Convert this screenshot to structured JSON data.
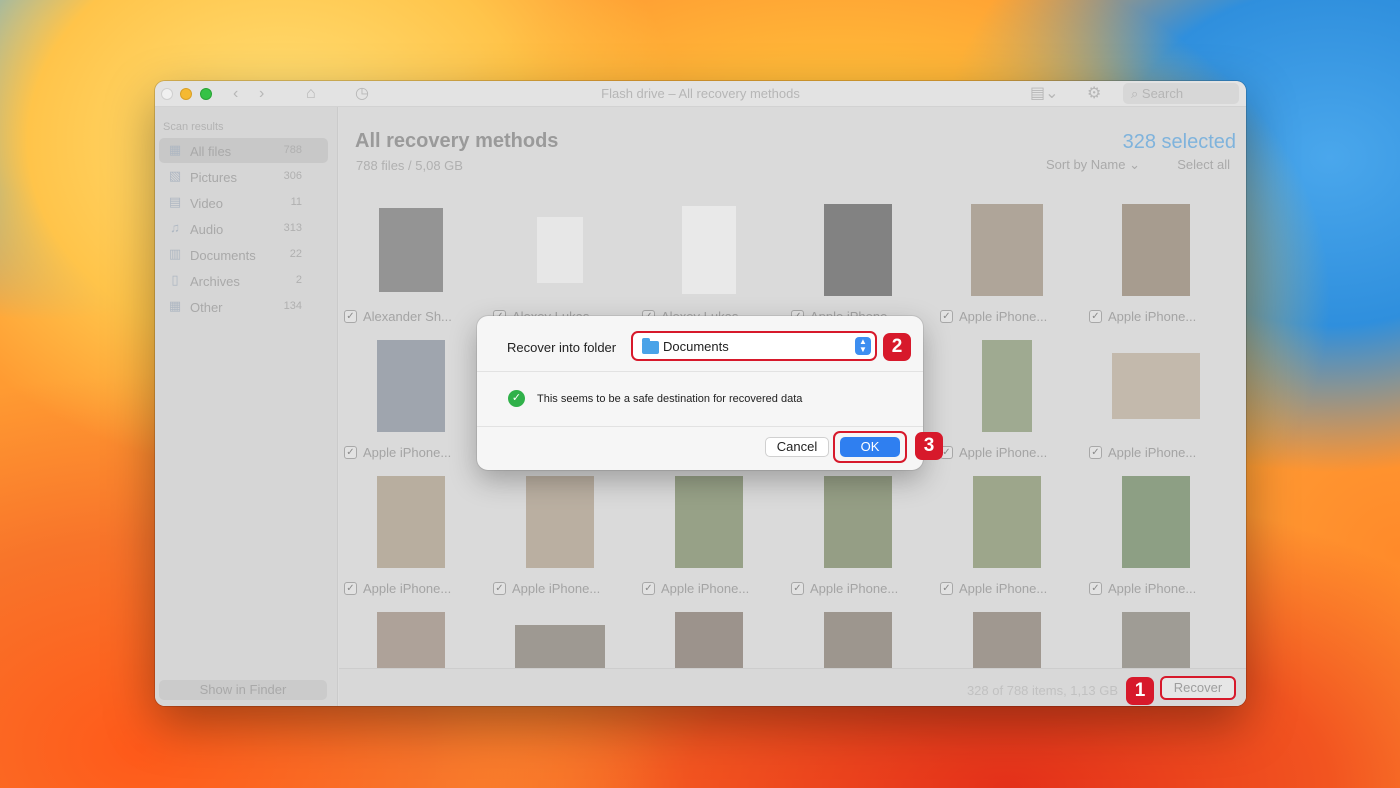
{
  "window": {
    "title": "Flash drive – All recovery methods",
    "search_placeholder": "Search"
  },
  "sidebar": {
    "heading": "Scan results",
    "items": [
      {
        "label": "All files",
        "count": "788",
        "icon": "all-files-icon"
      },
      {
        "label": "Pictures",
        "count": "306",
        "icon": "pictures-icon"
      },
      {
        "label": "Video",
        "count": "11",
        "icon": "video-icon"
      },
      {
        "label": "Audio",
        "count": "313",
        "icon": "audio-icon"
      },
      {
        "label": "Documents",
        "count": "22",
        "icon": "documents-icon"
      },
      {
        "label": "Archives",
        "count": "2",
        "icon": "archives-icon"
      },
      {
        "label": "Other",
        "count": "134",
        "icon": "other-icon"
      }
    ],
    "show_in_finder": "Show in Finder"
  },
  "main": {
    "title": "All recovery methods",
    "subtitle": "788 files / 5,08 GB",
    "selected": "328 selected",
    "sort": "Sort by Name",
    "select_all": "Select all"
  },
  "grid": {
    "rows": [
      [
        "Alexander Sh...",
        "Alexey Lukas...",
        "Alexey Lukas...",
        "Apple iPhone...",
        "Apple iPhone...",
        "Apple iPhone..."
      ],
      [
        "Apple iPhone...",
        "",
        "",
        "",
        "Apple iPhone...",
        "Apple iPhone..."
      ],
      [
        "Apple iPhone...",
        "Apple iPhone...",
        "Apple iPhone...",
        "Apple iPhone...",
        "Apple iPhone...",
        "Apple iPhone..."
      ],
      [
        "",
        "",
        "",
        "",
        "",
        ""
      ]
    ]
  },
  "bottom": {
    "status": "328 of 788 items, 1,13 GB",
    "recover": "Recover"
  },
  "dialog": {
    "label": "Recover into folder",
    "folder": "Documents",
    "message": "This seems to be a safe destination for recovered data",
    "cancel": "Cancel",
    "ok": "OK"
  },
  "badges": {
    "one": "1",
    "two": "2",
    "three": "3"
  },
  "colors": {
    "accent": "#2f7ff0",
    "highlight": "#d7192b",
    "success": "#30b14a"
  }
}
